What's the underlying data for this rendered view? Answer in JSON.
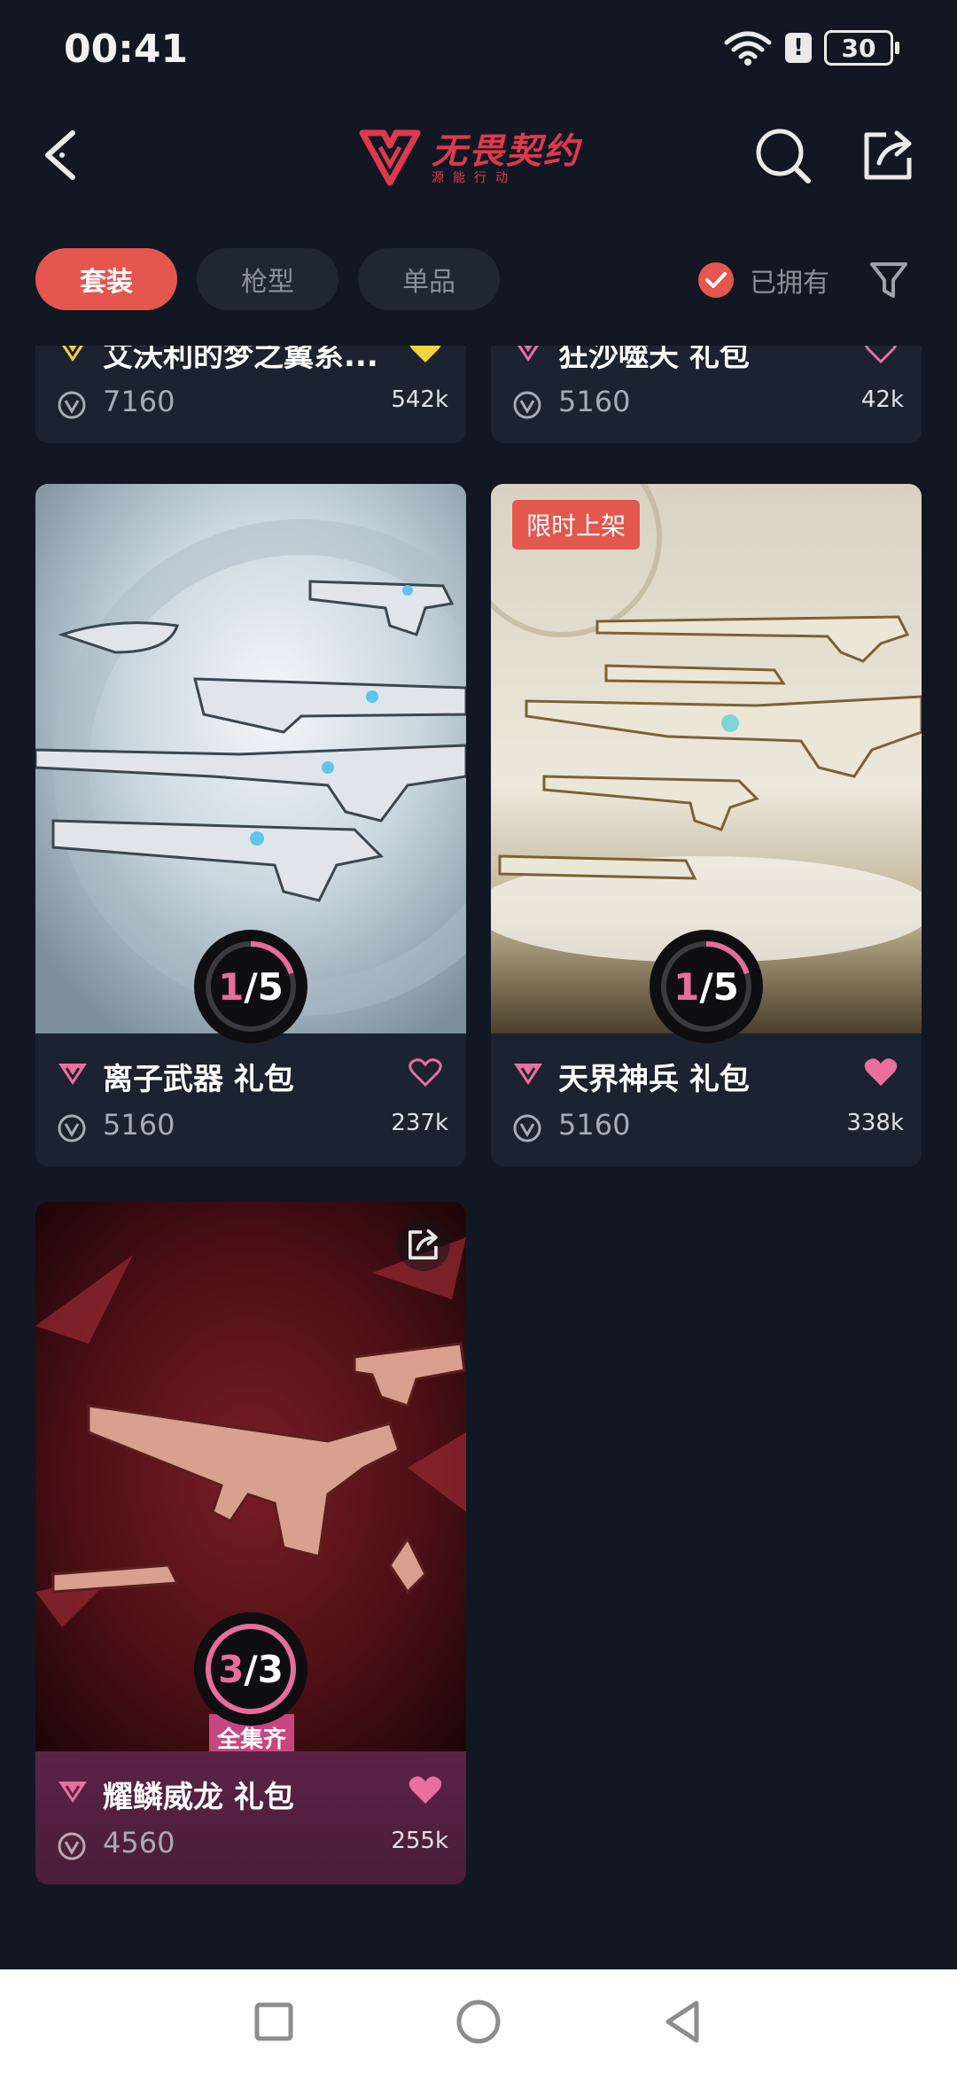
{
  "status_bar": {
    "time": "00:41",
    "battery": "30",
    "alert": "!"
  },
  "header": {
    "logo_title": "无畏契约",
    "logo_subtitle": "源能行动"
  },
  "tabs": [
    {
      "label": "套装",
      "active": true
    },
    {
      "label": "枪型",
      "active": false
    },
    {
      "label": "单品",
      "active": false
    }
  ],
  "owned_filter": {
    "label": "已拥有",
    "checked": true
  },
  "cards": [
    {
      "title": "艾沃利的梦之翼系...",
      "price": "7160",
      "likes": "542k",
      "tier_color": "#f2d23c",
      "liked": true,
      "heart_color": "#f2d23c"
    },
    {
      "title": "狂沙噬天 礼包",
      "price": "5160",
      "likes": "42k",
      "tier_color": "#e86fa0",
      "liked": false,
      "heart_color": "#e86fa0"
    },
    {
      "title": "离子武器 礼包",
      "price": "5160",
      "likes": "237k",
      "tier_color": "#e86fa0",
      "liked": false,
      "heart_color": "#e86fa0",
      "progress": {
        "owned": "1",
        "total": "5",
        "fraction": 0.2
      }
    },
    {
      "title": "天界神兵 礼包",
      "price": "5160",
      "likes": "338k",
      "tier_color": "#e86fa0",
      "liked": true,
      "heart_color": "#e86fa0",
      "badge": "限时上架",
      "progress": {
        "owned": "1",
        "total": "5",
        "fraction": 0.2
      }
    },
    {
      "title": "耀鳞威龙 礼包",
      "price": "4560",
      "likes": "255k",
      "tier_color": "#e86fa0",
      "liked": true,
      "heart_color": "#e86fa0",
      "complete_badge": "全集齐",
      "progress": {
        "owned": "3",
        "total": "3",
        "fraction": 1.0
      }
    }
  ],
  "colors": {
    "accent": "#e5564e",
    "pink": "#e86fa0",
    "background": "#111823",
    "card": "#1b2330"
  }
}
